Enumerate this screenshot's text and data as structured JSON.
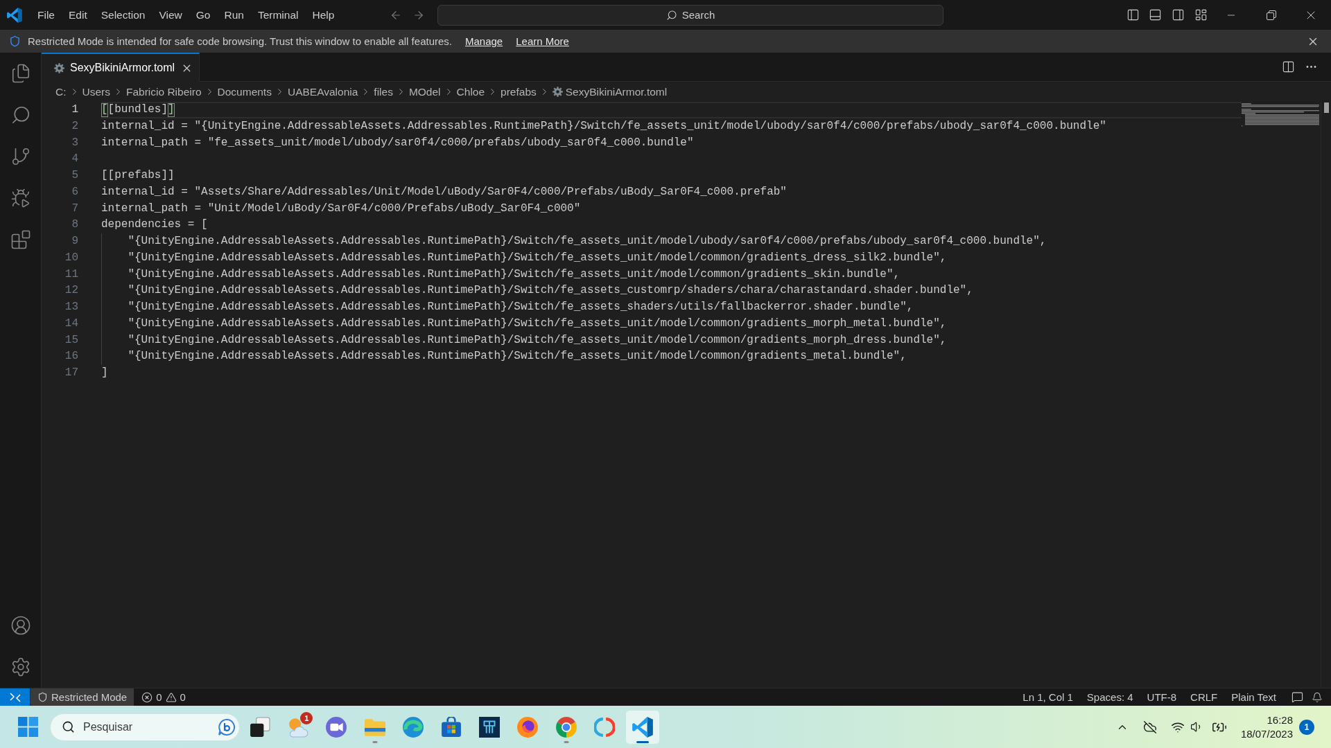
{
  "title_bar": {
    "menu": [
      "File",
      "Edit",
      "Selection",
      "View",
      "Go",
      "Run",
      "Terminal",
      "Help"
    ],
    "command_center": "Search"
  },
  "banner": {
    "text": "Restricted Mode is intended for safe code browsing. Trust this window to enable all features.",
    "links": [
      "Manage",
      "Learn More"
    ]
  },
  "tabs": [
    {
      "label": "SexyBikiniArmor.toml",
      "selected": true
    }
  ],
  "breadcrumbs": [
    "C:",
    "Users",
    "Fabricio Ribeiro",
    "Documents",
    "UABEAvalonia",
    "files",
    "MOdel",
    "Chloe",
    "prefabs",
    "SexyBikiniArmor.toml"
  ],
  "editor": {
    "lines": [
      {
        "number": "1",
        "text": "[[bundles]]",
        "current": true,
        "bracket_match": true
      },
      {
        "number": "2",
        "text": "internal_id = \"{UnityEngine.AddressableAssets.Addressables.RuntimePath}/Switch/fe_assets_unit/model/ubody/sar0f4/c000/prefabs/ubody_sar0f4_c000.bundle\"",
        "current": false,
        "bracket_match": false
      },
      {
        "number": "3",
        "text": "internal_path = \"fe_assets_unit/model/ubody/sar0f4/c000/prefabs/ubody_sar0f4_c000.bundle\"",
        "current": false,
        "bracket_match": false
      },
      {
        "number": "4",
        "current": false
      },
      {
        "number": "5",
        "text": "[[prefabs]]",
        "current": false,
        "bracket_match": false
      },
      {
        "number": "6",
        "text": "internal_id = \"Assets/Share/Addressables/Unit/Model/uBody/Sar0F4/c000/Prefabs/uBody_Sar0F4_c000.prefab\"",
        "current": false,
        "bracket_match": false
      },
      {
        "number": "7",
        "text": "internal_path = \"Unit/Model/uBody/Sar0F4/c000/Prefabs/uBody_Sar0F4_c000\"",
        "current": false,
        "bracket_match": false
      },
      {
        "number": "8",
        "text": "dependencies = [",
        "current": false,
        "bracket_match": false,
        "children": [
          {
            "number": "9",
            "text": "\"{UnityEngine.AddressableAssets.Addressables.RuntimePath}/Switch/fe_assets_unit/model/ubody/sar0f4/c000/prefabs/ubody_sar0f4_c000.bundle\",",
            "current": false,
            "bracket_match": false
          },
          {
            "number": "10",
            "text": "\"{UnityEngine.AddressableAssets.Addressables.RuntimePath}/Switch/fe_assets_unit/model/common/gradients_dress_silk2.bundle\",",
            "current": false,
            "bracket_match": false
          },
          {
            "number": "11",
            "text": "\"{UnityEngine.AddressableAssets.Addressables.RuntimePath}/Switch/fe_assets_unit/model/common/gradients_skin.bundle\",",
            "current": false,
            "bracket_match": false
          },
          {
            "number": "12",
            "text": "\"{UnityEngine.AddressableAssets.Addressables.RuntimePath}/Switch/fe_assets_customrp/shaders/chara/charastandard.shader.bundle\",",
            "current": false,
            "bracket_match": false
          },
          {
            "number": "13",
            "text": "\"{UnityEngine.AddressableAssets.Addressables.RuntimePath}/Switch/fe_assets_shaders/utils/fallbackerror.shader.bundle\",",
            "current": false,
            "bracket_match": false
          },
          {
            "number": "14",
            "text": "\"{UnityEngine.AddressableAssets.Addressables.RuntimePath}/Switch/fe_assets_unit/model/common/gradients_morph_metal.bundle\",",
            "current": false,
            "bracket_match": false
          },
          {
            "number": "15",
            "text": "\"{UnityEngine.AddressableAssets.Addressables.RuntimePath}/Switch/fe_assets_unit/model/common/gradients_morph_dress.bundle\",",
            "current": false,
            "bracket_match": false
          },
          {
            "number": "16",
            "text": "\"{UnityEngine.AddressableAssets.Addressables.RuntimePath}/Switch/fe_assets_unit/model/common/gradients_metal.bundle\",",
            "current": false,
            "bracket_match": false
          }
        ]
      },
      {
        "number": "17",
        "text": "]",
        "current": false,
        "bracket_match": false
      }
    ]
  },
  "status_bar": {
    "restricted_mode": "Restricted Mode",
    "errors": "0",
    "warnings": "0",
    "items": [
      "Ln 1, Col 1",
      "Spaces: 4",
      "UTF-8",
      "CRLF",
      "Plain Text"
    ]
  },
  "taskbar": {
    "search": "Pesquisar",
    "apps": [
      {
        "kind": "task_view",
        "running": false,
        "active": false
      },
      {
        "kind": "weather",
        "badge": "1",
        "running": false,
        "active": false
      },
      {
        "kind": "video_call",
        "running": false,
        "active": false
      },
      {
        "kind": "folder",
        "running": true,
        "active": false
      },
      {
        "kind": "swirl",
        "running": false,
        "active": false
      },
      {
        "kind": "store",
        "running": false,
        "active": false
      },
      {
        "kind": "tile",
        "running": false,
        "active": false
      },
      {
        "kind": "fox",
        "running": false,
        "active": false
      },
      {
        "kind": "tricolor",
        "running": true,
        "active": false
      },
      {
        "kind": "split_ring",
        "running": false,
        "active": false
      },
      {
        "kind": "ribbon",
        "running": true,
        "active": true
      }
    ],
    "clock": {
      "time": "16:28",
      "date": "18/07/2023"
    },
    "notifications": "1"
  }
}
